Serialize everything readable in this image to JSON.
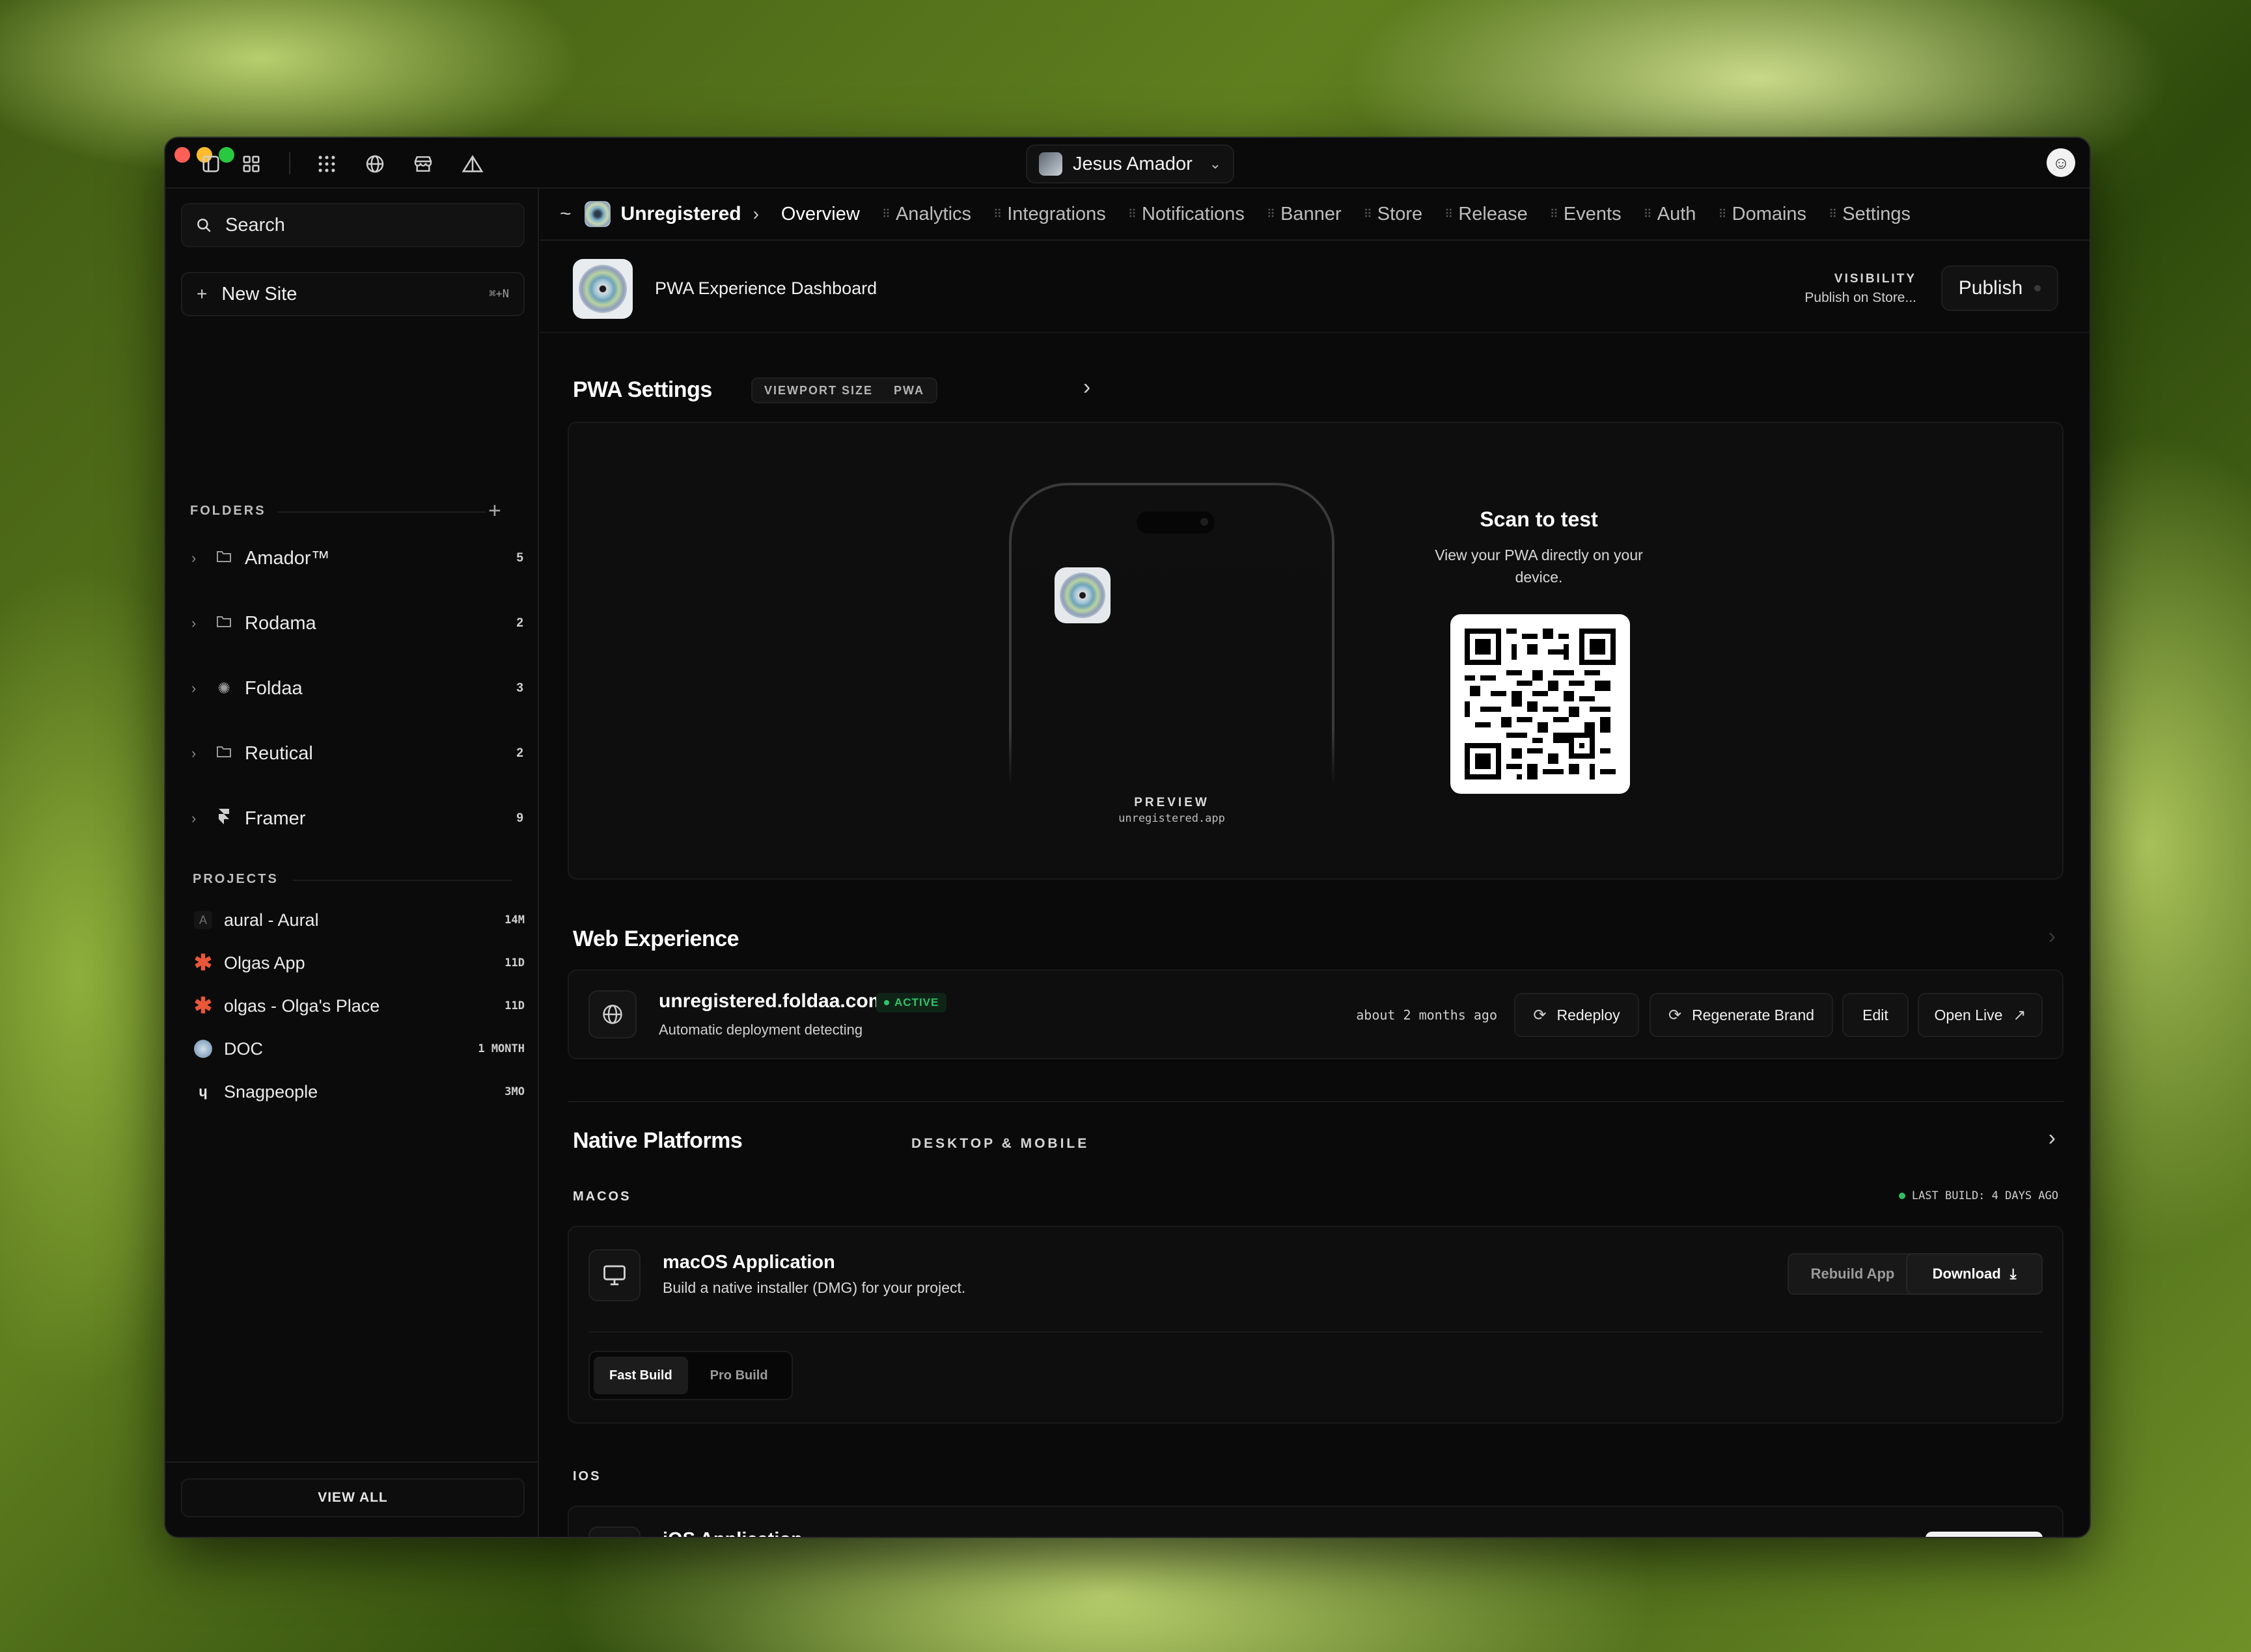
{
  "titlebar": {
    "user_name": "Jesus Amador",
    "icons": [
      "sidebar-panel-icon",
      "grid-icon",
      "dots-grid-icon",
      "globe-icon",
      "store-icon",
      "triangle-split-icon"
    ]
  },
  "sidebar": {
    "search_placeholder": "Search",
    "new_site_label": "New Site",
    "new_site_shortcut": "⌘+N",
    "folders_label": "FOLDERS",
    "folders": [
      {
        "name": "Amador™",
        "count": "5",
        "icon": "folder-icon"
      },
      {
        "name": "Rodama",
        "count": "2",
        "icon": "folder-icon"
      },
      {
        "name": "Foldaa",
        "count": "3",
        "icon": "spinner-icon"
      },
      {
        "name": "Reutical",
        "count": "2",
        "icon": "folder-icon"
      },
      {
        "name": "Framer",
        "count": "9",
        "icon": "framer-icon"
      }
    ],
    "projects_label": "PROJECTS",
    "projects": [
      {
        "name": "aural - Aural",
        "age": "14M",
        "icon": "letter-a-icon"
      },
      {
        "name": "Olgas App",
        "age": "11D",
        "icon": "asterisk-icon"
      },
      {
        "name": "olgas - Olga's Place",
        "age": "11D",
        "icon": "asterisk-icon"
      },
      {
        "name": "DOC",
        "age": "1 MONTH",
        "icon": "globe-icon"
      },
      {
        "name": "Snagpeople",
        "age": "3MO",
        "icon": "snag-icon"
      }
    ],
    "view_all_label": "VIEW ALL"
  },
  "nav": {
    "tilde": "~",
    "site_name": "Unregistered",
    "tabs": [
      "Overview",
      "Analytics",
      "Integrations",
      "Notifications",
      "Banner",
      "Store",
      "Release",
      "Events",
      "Auth",
      "Domains",
      "Settings"
    ],
    "active_tab": "Overview"
  },
  "header": {
    "title": "PWA Experience Dashboard",
    "visibility_label": "VISIBILITY",
    "visibility_value": "Publish on Store...",
    "publish_label": "Publish"
  },
  "pwa": {
    "title": "PWA Settings",
    "tag_left": "VIEWPORT SIZE",
    "tag_right": "PWA",
    "preview_label": "PREVIEW",
    "preview_url": "unregistered.app",
    "scan_title": "Scan to test",
    "scan_desc": "View your PWA directly on your device."
  },
  "web": {
    "title": "Web Experience",
    "domain": "unregistered.foldaa.com",
    "status": "ACTIVE",
    "subtitle": "Automatic deployment detecting",
    "updated": "about 2 months ago",
    "buttons": {
      "redeploy": "Redeploy",
      "regenerate": "Regenerate Brand",
      "edit": "Edit",
      "open_live": "Open Live"
    }
  },
  "native": {
    "title": "Native Platforms",
    "subtitle": "DESKTOP & MOBILE",
    "macos_label": "MACOS",
    "last_build": "LAST BUILD: 4 DAYS AGO",
    "mac_title": "macOS Application",
    "mac_desc": "Build a native installer (DMG) for your project.",
    "rebuild_label": "Rebuild App",
    "download_label": "Download",
    "build_options": [
      "Fast Build",
      "Pro Build"
    ],
    "selected_build": "Fast Build",
    "ios_label": "IOS",
    "ios_title": "iOS Application"
  },
  "colors": {
    "active_green": "#32c36a",
    "close": "#ff5f57",
    "minimize": "#febc2e",
    "maximize": "#28c840",
    "asterisk": "#e8573a"
  }
}
